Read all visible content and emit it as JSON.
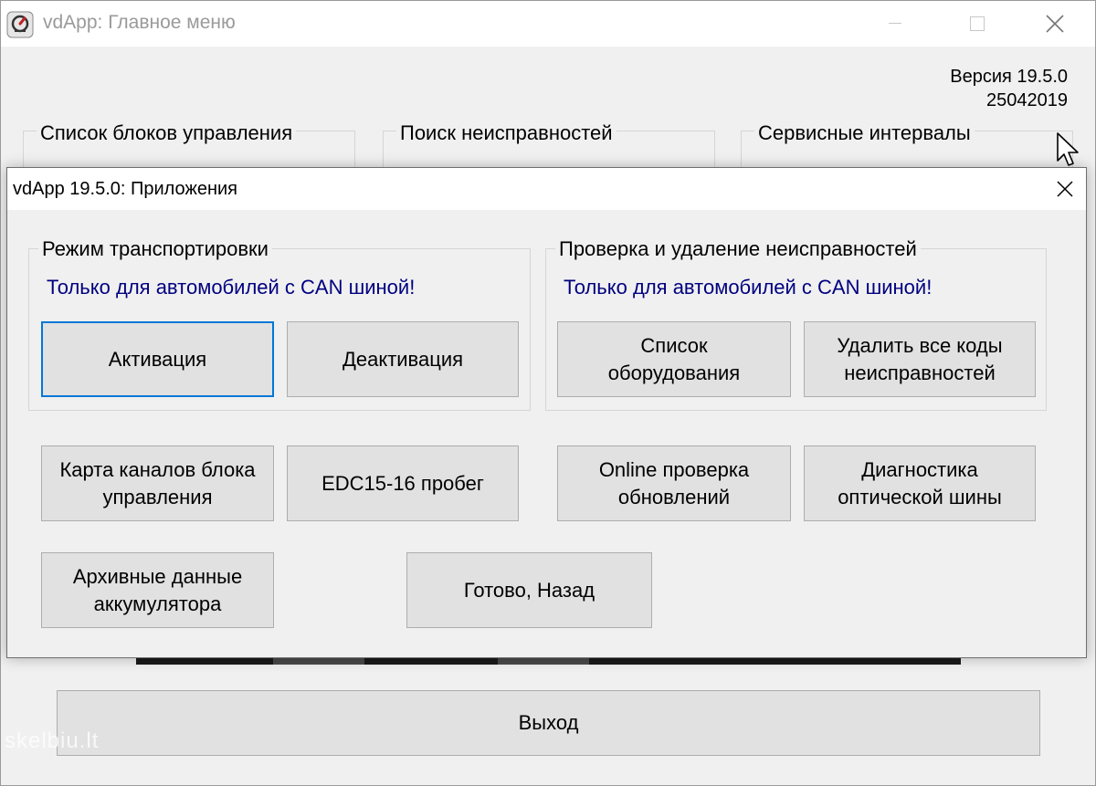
{
  "main_window": {
    "title": "vdApp:  Главное меню",
    "version_line1": "Версия 19.5.0",
    "version_line2": "25042019",
    "groups": [
      {
        "label": "Список блоков управления"
      },
      {
        "label": "Поиск неисправностей"
      },
      {
        "label": "Сервисные интервалы"
      }
    ],
    "exit_label": "Выход",
    "watermark": "skelbiu.lt"
  },
  "dialog": {
    "title": "vdApp 19.5.0:  Приложения",
    "transport_group": {
      "label": "Режим транспортировки",
      "note": "Только для автомобилей с CAN шиной!",
      "activate_label": "Активация",
      "deactivate_label": "Деактивация"
    },
    "fault_group": {
      "label": "Проверка и удаление неисправностей",
      "note": "Только для автомобилей с CAN шиной!",
      "equipment_list_line1": "Список",
      "equipment_list_line2": "оборудования",
      "delete_codes_line1": "Удалить все коды",
      "delete_codes_line2": "неисправностей"
    },
    "buttons": {
      "channel_map_line1": "Карта каналов блока",
      "channel_map_line2": "управления",
      "edc_mileage": "EDC15-16 пробег",
      "online_check_line1": "Online проверка",
      "online_check_line2": "обновлений",
      "optical_diag_line1": "Диагностика",
      "optical_diag_line2": "оптической шины",
      "battery_archive_line1": "Архивные данные",
      "battery_archive_line2": "аккумулятора",
      "done_back": "Готово, Назад"
    }
  },
  "icons": {
    "app": "stethoscope-icon",
    "minimize": "minimize-icon",
    "maximize": "maximize-icon",
    "close": "close-icon",
    "cursor": "mouse-cursor-icon"
  },
  "colors": {
    "note_text": "#000080",
    "focus_border": "#0078d7",
    "button_face": "#e1e1e1",
    "window_bg": "#f0f0f0"
  }
}
